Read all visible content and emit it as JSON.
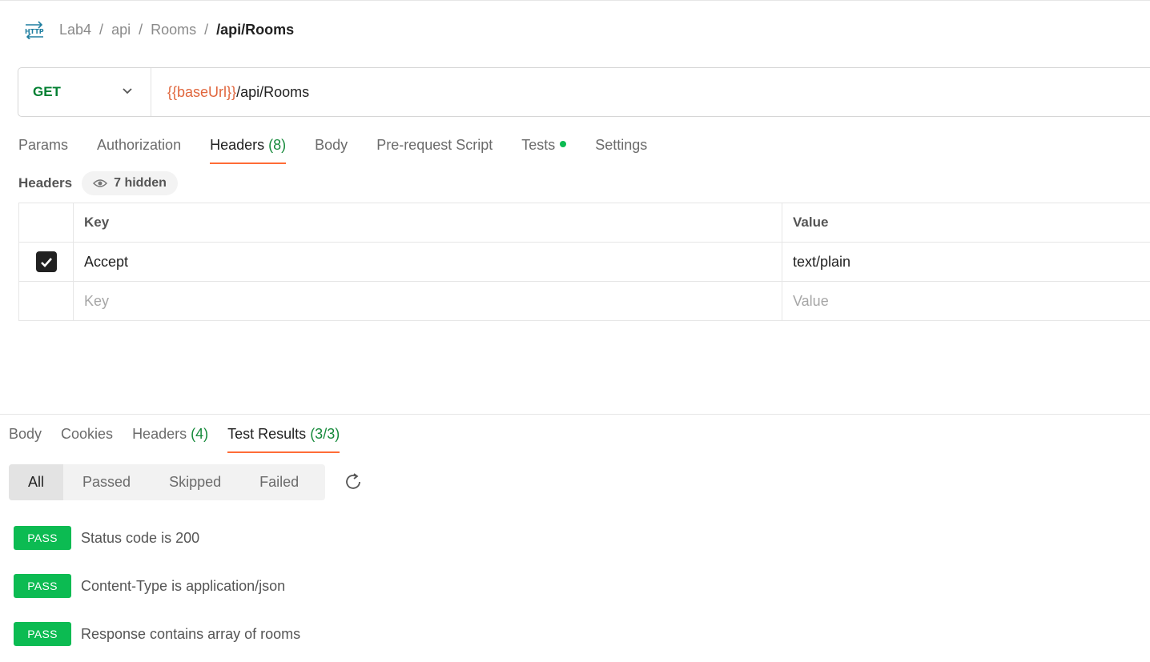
{
  "breadcrumb": {
    "icon": "http-icon",
    "items": [
      "Lab4",
      "api",
      "Rooms"
    ],
    "separator": "/",
    "current": "/api/Rooms"
  },
  "request": {
    "method": "GET",
    "url_variable": "{{baseUrl}}",
    "url_path": "/api/Rooms",
    "method_color": "#007f31",
    "variable_color": "#e0663d"
  },
  "request_tabs": [
    {
      "label": "Params",
      "count": ""
    },
    {
      "label": "Authorization",
      "count": ""
    },
    {
      "label": "Headers",
      "count": "(8)"
    },
    {
      "label": "Body",
      "count": ""
    },
    {
      "label": "Pre-request Script",
      "count": ""
    },
    {
      "label": "Tests",
      "count": ""
    },
    {
      "label": "Settings",
      "count": ""
    }
  ],
  "active_request_tab": "Headers",
  "headers_section": {
    "title": "Headers",
    "hidden_label": "7 hidden",
    "columns": {
      "key": "Key",
      "value": "Value"
    },
    "rows": [
      {
        "checked": true,
        "key": "Accept",
        "value": "text/plain"
      }
    ],
    "placeholder_key": "Key",
    "placeholder_value": "Value"
  },
  "response_tabs": [
    {
      "label": "Body",
      "count": ""
    },
    {
      "label": "Cookies",
      "count": ""
    },
    {
      "label": "Headers",
      "count": "(4)"
    },
    {
      "label": "Test Results",
      "count": "(3/3)"
    }
  ],
  "active_response_tab": "Test Results",
  "filters": [
    "All",
    "Passed",
    "Skipped",
    "Failed"
  ],
  "active_filter": "All",
  "test_results": [
    {
      "status": "PASS",
      "name": "Status code is 200"
    },
    {
      "status": "PASS",
      "name": "Content-Type is application/json"
    },
    {
      "status": "PASS",
      "name": "Response contains array of rooms"
    }
  ],
  "colors": {
    "accent": "#ff6c37",
    "pass": "#0cbb52",
    "count": "#168a3b"
  }
}
